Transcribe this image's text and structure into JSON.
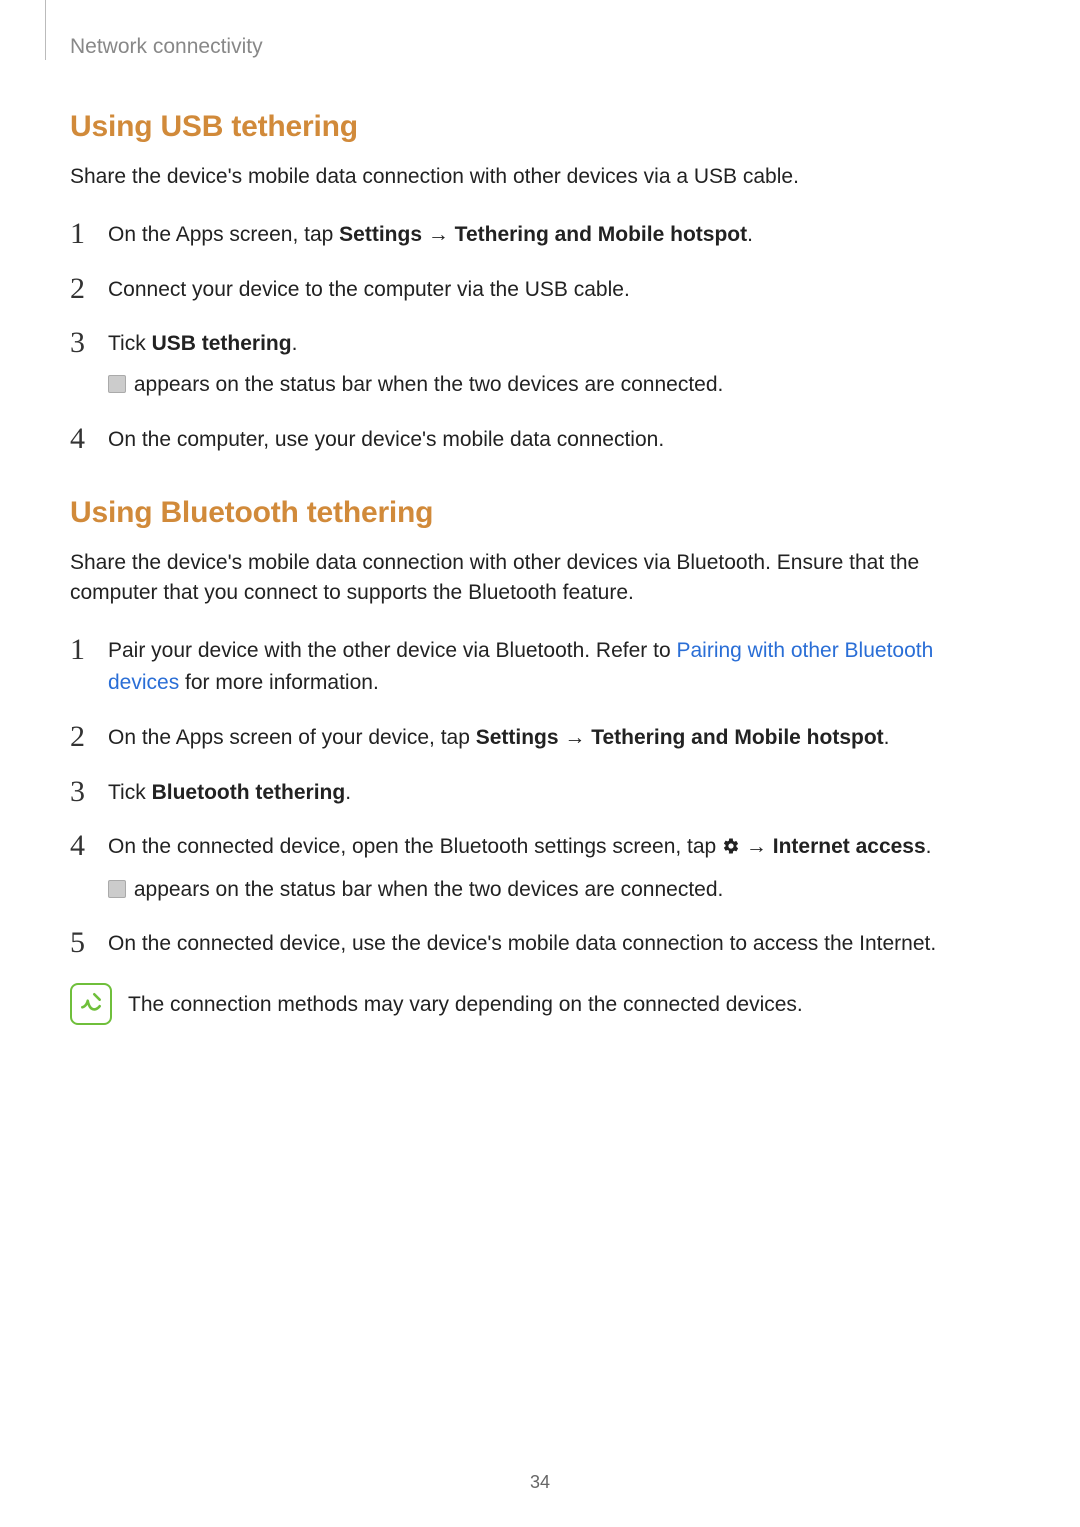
{
  "breadcrumb": "Network connectivity",
  "usb": {
    "heading": "Using USB tethering",
    "intro": "Share the device's mobile data connection with other devices via a USB cable.",
    "step1_pre": "On the Apps screen, tap ",
    "step1_bold1": "Settings",
    "step1_arrow": " → ",
    "step1_bold2": "Tethering and Mobile hotspot",
    "step1_post": ".",
    "step2": "Connect your device to the computer via the USB cable.",
    "step3_pre": "Tick ",
    "step3_bold": "USB tethering",
    "step3_post": ".",
    "step3_sub": " appears on the status bar when the two devices are connected.",
    "step4": "On the computer, use your device's mobile data connection."
  },
  "bt": {
    "heading": "Using Bluetooth tethering",
    "intro": "Share the device's mobile data connection with other devices via Bluetooth. Ensure that the computer that you connect to supports the Bluetooth feature.",
    "step1_pre": "Pair your device with the other device via Bluetooth. Refer to ",
    "step1_link": "Pairing with other Bluetooth devices",
    "step1_post": " for more information.",
    "step2_pre": "On the Apps screen of your device, tap ",
    "step2_bold1": "Settings",
    "step2_arrow": " → ",
    "step2_bold2": "Tethering and Mobile hotspot",
    "step2_post": ".",
    "step3_pre": "Tick ",
    "step3_bold": "Bluetooth tethering",
    "step3_post": ".",
    "step4_pre": "On the connected device, open the Bluetooth settings screen, tap ",
    "step4_arrow": " → ",
    "step4_bold": "Internet access",
    "step4_post": ".",
    "step4_sub": " appears on the status bar when the two devices are connected.",
    "step5": "On the connected device, use the device's mobile data connection to access the Internet."
  },
  "note": "The connection methods may vary depending on the connected devices.",
  "pagenum": "34",
  "nums": {
    "1": "1",
    "2": "2",
    "3": "3",
    "4": "4",
    "5": "5"
  }
}
